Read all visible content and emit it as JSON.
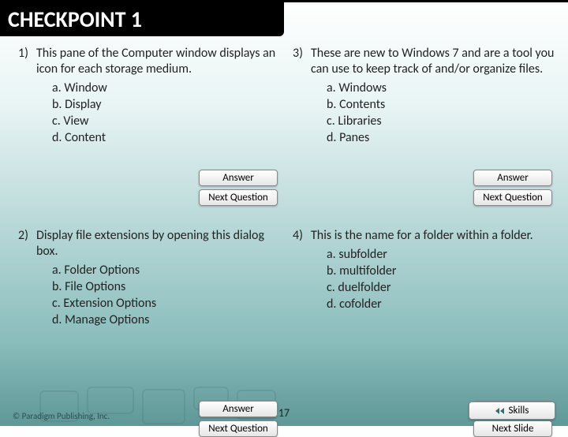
{
  "header": {
    "title": "CHECKPOINT 1"
  },
  "questions": [
    {
      "num": "1)",
      "text": "This pane of the Computer window displays an icon for each storage medium.",
      "options": [
        "a.   Window",
        "b.   Display",
        "c.   View",
        "d.   Content"
      ],
      "btn1": "Answer",
      "btn2": "Next Question"
    },
    {
      "num": "3)",
      "text": "These are new to Windows 7 and are a tool you can use to keep track of and/or organize files.",
      "options": [
        "a.   Windows",
        "b.   Contents",
        "c.   Libraries",
        "d.   Panes"
      ],
      "btn1": "Answer",
      "btn2": "Next Question"
    },
    {
      "num": "2)",
      "text": "Display file extensions by opening this dialog box.",
      "options": [
        "a.   Folder Options",
        "b.   File Options",
        "c.   Extension Options",
        "d.   Manage Options"
      ],
      "btn1": "Answer",
      "btn2": "Next Question"
    },
    {
      "num": "4)",
      "text": "This is the name for a folder within a folder.",
      "options": [
        "a.   subfolder",
        "b.   multifolder",
        "c.   duelfolder",
        "d.   cofolder"
      ],
      "btn1": "Answer",
      "btn2": "Next Slide"
    }
  ],
  "footer": {
    "copyright": "© Paradigm Publishing, Inc.",
    "page": "17",
    "skills": "Skills"
  }
}
